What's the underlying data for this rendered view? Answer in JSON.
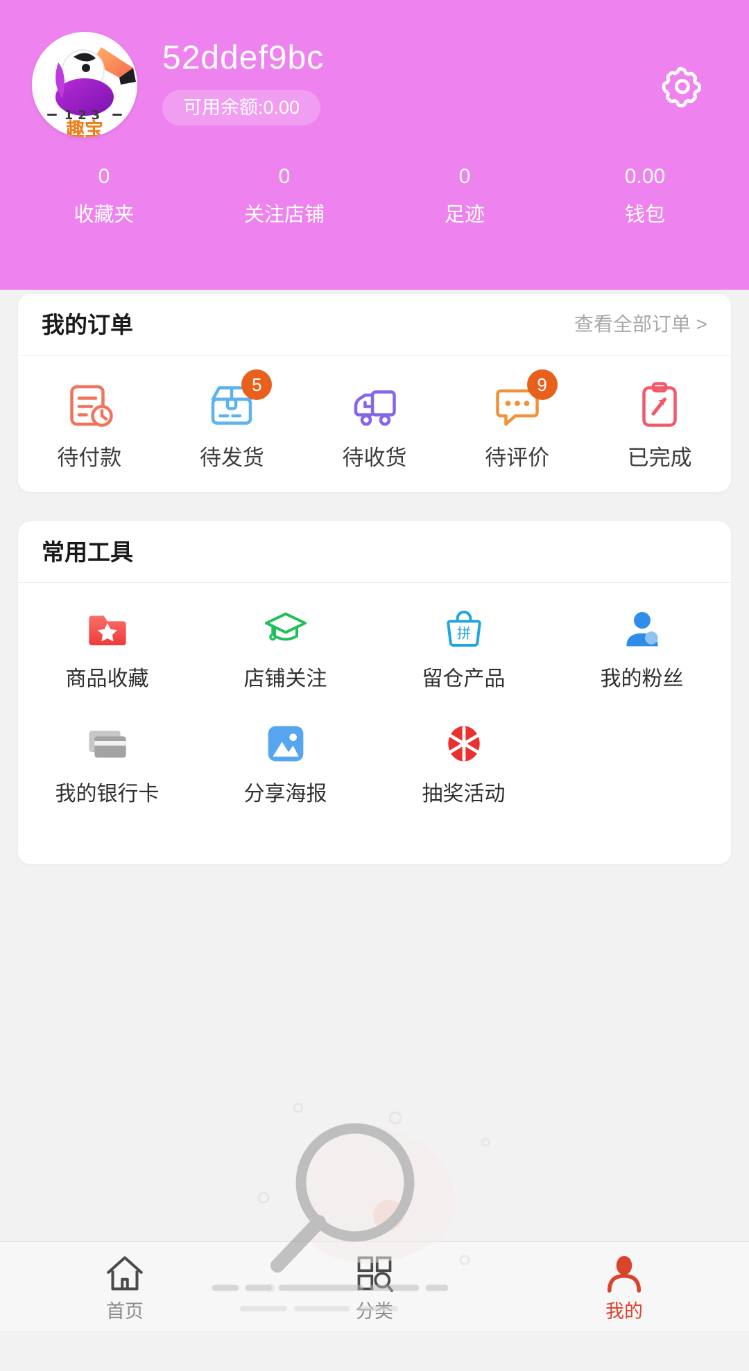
{
  "header": {
    "username": "52ddef9bc",
    "balance_label": "可用余额:0.00",
    "settings_icon": "gear-icon",
    "avatar_icon": "bird-logo-avatar",
    "avatar_text_numbers": "1 2 3",
    "avatar_text_brand": "趣宝",
    "background_color": "#ee82ee",
    "stats": [
      {
        "value": "0",
        "label": "收藏夹"
      },
      {
        "value": "0",
        "label": "关注店铺"
      },
      {
        "value": "0",
        "label": "足迹"
      },
      {
        "value": "0.00",
        "label": "钱包"
      }
    ]
  },
  "orders": {
    "title": "我的订单",
    "more_label": "查看全部订单 >",
    "badge_color": "#e8601c",
    "items": [
      {
        "label": "待付款",
        "badge": "",
        "icon": "invoice-clock-icon",
        "color": "#f2735b"
      },
      {
        "label": "待发货",
        "badge": "5",
        "icon": "package-box-icon",
        "color": "#5cb3f0"
      },
      {
        "label": "待收货",
        "badge": "",
        "icon": "delivery-truck-icon",
        "color": "#8566e8"
      },
      {
        "label": "待评价",
        "badge": "9",
        "icon": "comment-dots-icon",
        "color": "#ef9238"
      },
      {
        "label": "已完成",
        "badge": "",
        "icon": "clipboard-check-icon",
        "color": "#f2596b"
      }
    ]
  },
  "tools": {
    "title": "常用工具",
    "items": [
      {
        "label": "商品收藏",
        "icon": "folder-star-icon",
        "color": "#f2534e"
      },
      {
        "label": "店铺关注",
        "icon": "graduation-cap-icon",
        "color": "#1fc05a"
      },
      {
        "label": "留仓产品",
        "icon": "shopping-bag-pin-icon",
        "color": "#1fa6e0"
      },
      {
        "label": "我的粉丝",
        "icon": "user-person-icon",
        "color": "#2f8fe8"
      },
      {
        "label": "我的银行卡",
        "icon": "bank-cards-icon",
        "color": "#a8a8a8"
      },
      {
        "label": "分享海报",
        "icon": "image-picture-icon",
        "color": "#4a9bea"
      },
      {
        "label": "抽奖活动",
        "icon": "lottery-wheel-icon",
        "color": "#e8303c"
      }
    ]
  },
  "empty_state": {
    "icon": "magnifier-empty-illustration"
  },
  "tabbar": {
    "active": "我的",
    "items": [
      {
        "label": "首页",
        "icon": "home-icon",
        "active": false
      },
      {
        "label": "分类",
        "icon": "category-icon",
        "active": false
      },
      {
        "label": "我的",
        "icon": "user-icon",
        "active": true
      }
    ],
    "active_color": "#d8452c",
    "inactive_color": "#8a8a8a"
  }
}
